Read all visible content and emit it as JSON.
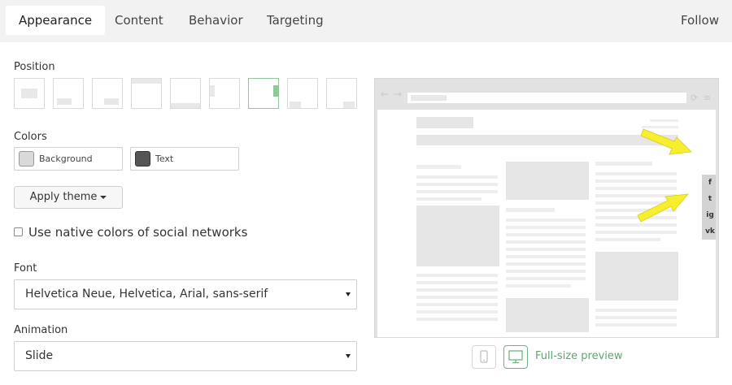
{
  "tabs": [
    {
      "label": "Appearance",
      "active": true
    },
    {
      "label": "Content",
      "active": false
    },
    {
      "label": "Behavior",
      "active": false
    },
    {
      "label": "Targeting",
      "active": false
    }
  ],
  "follow_label": "Follow",
  "position": {
    "label": "Position",
    "options_count_note": "",
    "selected_index": 6
  },
  "colors": {
    "label": "Colors",
    "background": {
      "label": "Background",
      "swatch": "#d9d9d9"
    },
    "text": {
      "label": "Text",
      "swatch": "#555555"
    }
  },
  "apply_theme_label": "Apply theme",
  "native_colors": {
    "label": "Use native colors of social networks",
    "checked": false
  },
  "font": {
    "label": "Font",
    "value": "Helvetica Neue, Helvetica, Arial, sans-serif"
  },
  "animation": {
    "label": "Animation",
    "value": "Slide"
  },
  "preview": {
    "social_icons": [
      "f",
      "t",
      "ig",
      "vk"
    ],
    "full_size_label": "Full-size preview"
  },
  "colors_accent": {
    "selected_green": "#8fc99b",
    "link_green": "#5fa46e",
    "arrow_yellow": "#f6ee2e"
  }
}
